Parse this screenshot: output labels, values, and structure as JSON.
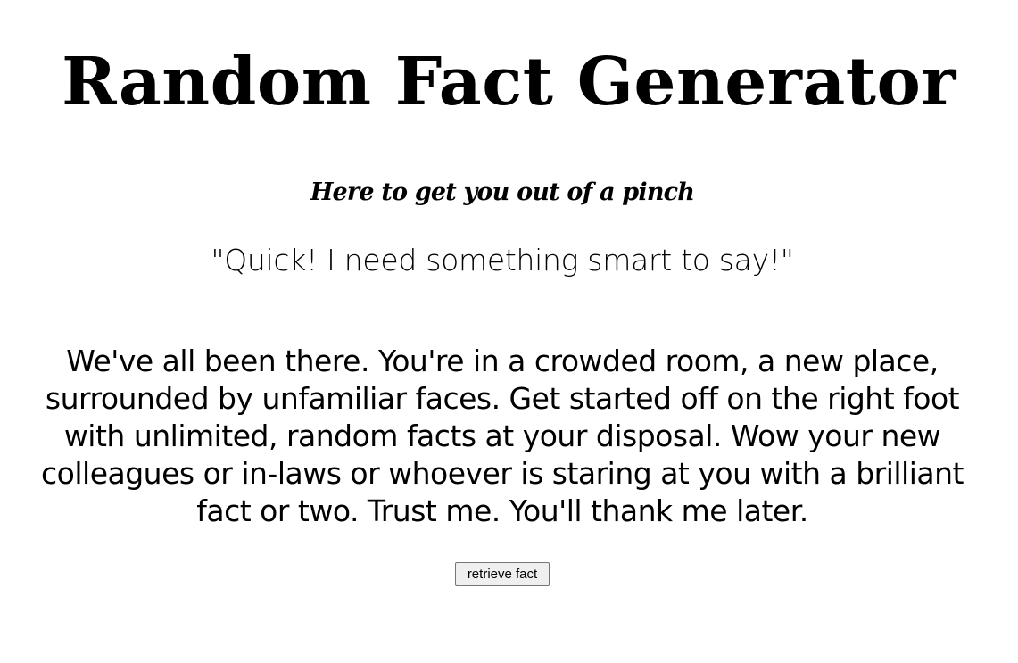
{
  "header": {
    "title": "Random Fact Generator",
    "subtitle": "Here to get you out of a pinch"
  },
  "main": {
    "quote": "\"Quick! I need something smart to say!\"",
    "description": "We've all been there. You're in a crowded room, a new place, surrounded by unfamiliar faces. Get started off on the right foot with unlimited, random facts at your disposal. Wow your new colleagues or in-laws or whoever is staring at you with a brilliant fact or two. Trust me. You'll thank me later.",
    "button_label": "retrieve fact"
  }
}
